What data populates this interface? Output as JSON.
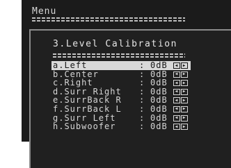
{
  "back_menu": {
    "title": "Menu"
  },
  "level_calibration": {
    "title": "3.Level Calibration",
    "left_arrow_glyph": "◀",
    "right_arrow_glyph": "▶",
    "items": [
      {
        "label": "a.Left",
        "separator": ":",
        "value": "0dB",
        "selected": true
      },
      {
        "label": "b.Center",
        "separator": ":",
        "value": "0dB",
        "selected": false
      },
      {
        "label": "c.Right",
        "separator": ":",
        "value": "0dB",
        "selected": false
      },
      {
        "label": "d.Surr Right",
        "separator": ":",
        "value": "0dB",
        "selected": false
      },
      {
        "label": "e.SurrBack R",
        "separator": ":",
        "value": "0dB",
        "selected": false
      },
      {
        "label": "f.SurrBack L",
        "separator": ":",
        "value": "0dB",
        "selected": false
      },
      {
        "label": "g.Surr Left",
        "separator": ":",
        "value": "0dB",
        "selected": false
      },
      {
        "label": "h.Subwoofer",
        "separator": ":",
        "value": "0dB",
        "selected": false
      }
    ]
  },
  "colors": {
    "screen_back": "#1b1b1b",
    "screen_front": "#202020",
    "text": "#d6d6d6",
    "highlight": "#d9d9d9"
  }
}
